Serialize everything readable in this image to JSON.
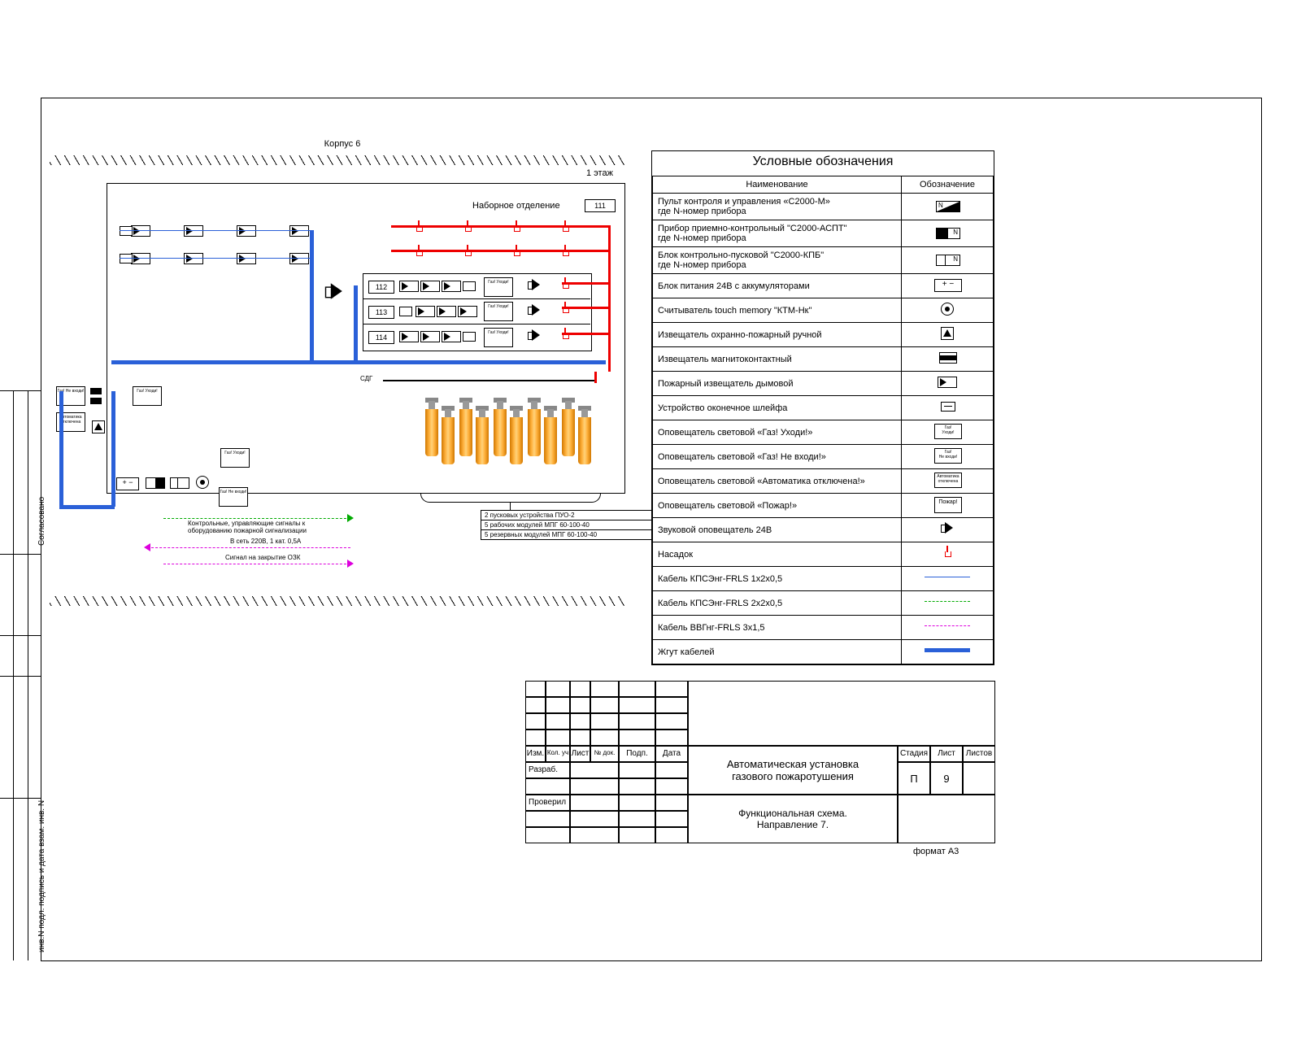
{
  "header": {
    "building": "Корпус 6",
    "floor": "1 этаж"
  },
  "room": {
    "title": "Наборное отделение",
    "main_number": "111",
    "rooms": [
      "112",
      "113",
      "114"
    ]
  },
  "equipment_notes": [
    "2 пусковых устройства ПУО-2",
    "5 рабочих модулей МПГ 60-100-40",
    "5 резервных модулей МПГ 60-100-40"
  ],
  "abbrev": {
    "sdg": "СДГ"
  },
  "signals": {
    "control": "Контрольные, управляющие сигналы к оборудованию пожарной сигнализации",
    "power": "В сеть 220В, 1 кат. 0,5А",
    "ozk": "Сигнал на закрытие ОЗК"
  },
  "signs": {
    "not_enter": "Газ!\nНе входи!",
    "leave": "Газ!\nУходи!",
    "auto_off": "Автоматика\nотключена",
    "fire": "Пожар!"
  },
  "legend": {
    "title": "Условные обозначения",
    "headers": {
      "name": "Наименование",
      "symbol": "Обозначение"
    },
    "rows": [
      {
        "name": "Пульт контроля и управления «С2000-М»\nгде N-номер прибора",
        "sym": "c2000m"
      },
      {
        "name": "Прибор приемно-контрольный \"С2000-АСПТ\"\nгде N-номер прибора",
        "sym": "aspt"
      },
      {
        "name": "Блок контрольно-пусковой \"С2000-КПБ\"\nгде N-номер прибора",
        "sym": "kpb"
      },
      {
        "name": "Блок питания 24В с аккумуляторами",
        "sym": "psu"
      },
      {
        "name": "Считыватель touch memory \"КТМ-Нк\"",
        "sym": "touch"
      },
      {
        "name": "Извещатель охранно-пожарный ручной",
        "sym": "manual"
      },
      {
        "name": "Извещатель магнитоконтактный",
        "sym": "magnet"
      },
      {
        "name": "Пожарный извещатель дымовой",
        "sym": "smoke"
      },
      {
        "name": "Устройство оконечное шлейфа",
        "sym": "term"
      },
      {
        "name": "Оповещатель световой «Газ! Уходи!»",
        "sym": "sign_leave"
      },
      {
        "name": "Оповещатель световой «Газ! Не входи!»",
        "sym": "sign_not_enter"
      },
      {
        "name": "Оповещатель световой «Автоматика отключена!»",
        "sym": "sign_auto"
      },
      {
        "name": "Оповещатель световой «Пожар!»",
        "sym": "sign_fire"
      },
      {
        "name": "Звуковой оповещатель 24В",
        "sym": "speaker"
      },
      {
        "name": "Насадок",
        "sym": "nozzle"
      },
      {
        "name": "Кабель КПСЭнг-FRLS 1x2x0,5",
        "sym": "line_blue_thin"
      },
      {
        "name": "Кабель КПСЭнг-FRLS 2x2x0,5",
        "sym": "line_green_dash"
      },
      {
        "name": "Кабель ВВГнг-FRLS 3x1,5",
        "sym": "line_magenta_dash"
      },
      {
        "name": "Жгут кабелей",
        "sym": "line_blue_thick"
      }
    ]
  },
  "title_block": {
    "rev_headers": [
      "Изм.",
      "Кол. уч",
      "Лист",
      "№ док.",
      "Подп.",
      "Дата"
    ],
    "roles": [
      "Разраб.",
      "Проверил"
    ],
    "project_title": "Автоматическая установка\nгазового пожаротушения",
    "sheet_title": "Функциональная схема.\nНаправление 7.",
    "cols": {
      "stage": "Стадия",
      "sheet": "Лист",
      "sheets": "Листов",
      "stage_val": "П",
      "sheet_val": "9",
      "sheets_val": ""
    },
    "format": "формат  А3"
  },
  "side_stamp": [
    "Согласовано",
    "инв.N  подл.  подпись и дата  взам. инв. N"
  ]
}
